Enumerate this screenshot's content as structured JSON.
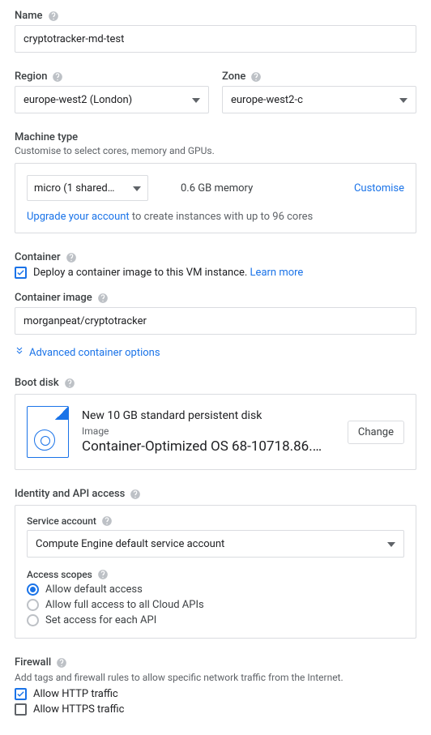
{
  "name": {
    "label": "Name",
    "value": "cryptotracker-md-test"
  },
  "region": {
    "label": "Region",
    "value": "europe-west2 (London)"
  },
  "zone": {
    "label": "Zone",
    "value": "europe-west2-c"
  },
  "machine": {
    "label": "Machine type",
    "desc": "Customise to select cores, memory and GPUs.",
    "type_value": "micro (1 shared…",
    "memory": "0.6 GB memory",
    "customise": "Customise",
    "upgrade_link": "Upgrade your account",
    "upgrade_rest": " to create instances with up to 96 cores"
  },
  "container": {
    "label": "Container",
    "deploy_label": "Deploy a container image to this VM instance. ",
    "learn_more": "Learn more",
    "image_label": "Container image",
    "image_value": "morganpeat/cryptotracker",
    "adv_label": "Advanced container options"
  },
  "boot": {
    "label": "Boot disk",
    "title": "New 10 GB standard persistent disk",
    "sub": "Image",
    "os": "Container-Optimized OS 68-10718.86.…",
    "change": "Change"
  },
  "identity": {
    "label": "Identity and API access",
    "service_label": "Service account",
    "service_value": "Compute Engine default service account",
    "scopes_label": "Access scopes",
    "scopes": [
      "Allow default access",
      "Allow full access to all Cloud APIs",
      "Set access for each API"
    ]
  },
  "firewall": {
    "label": "Firewall",
    "desc": "Add tags and firewall rules to allow specific network traffic from the Internet.",
    "http": "Allow HTTP traffic",
    "https": "Allow HTTPS traffic"
  }
}
